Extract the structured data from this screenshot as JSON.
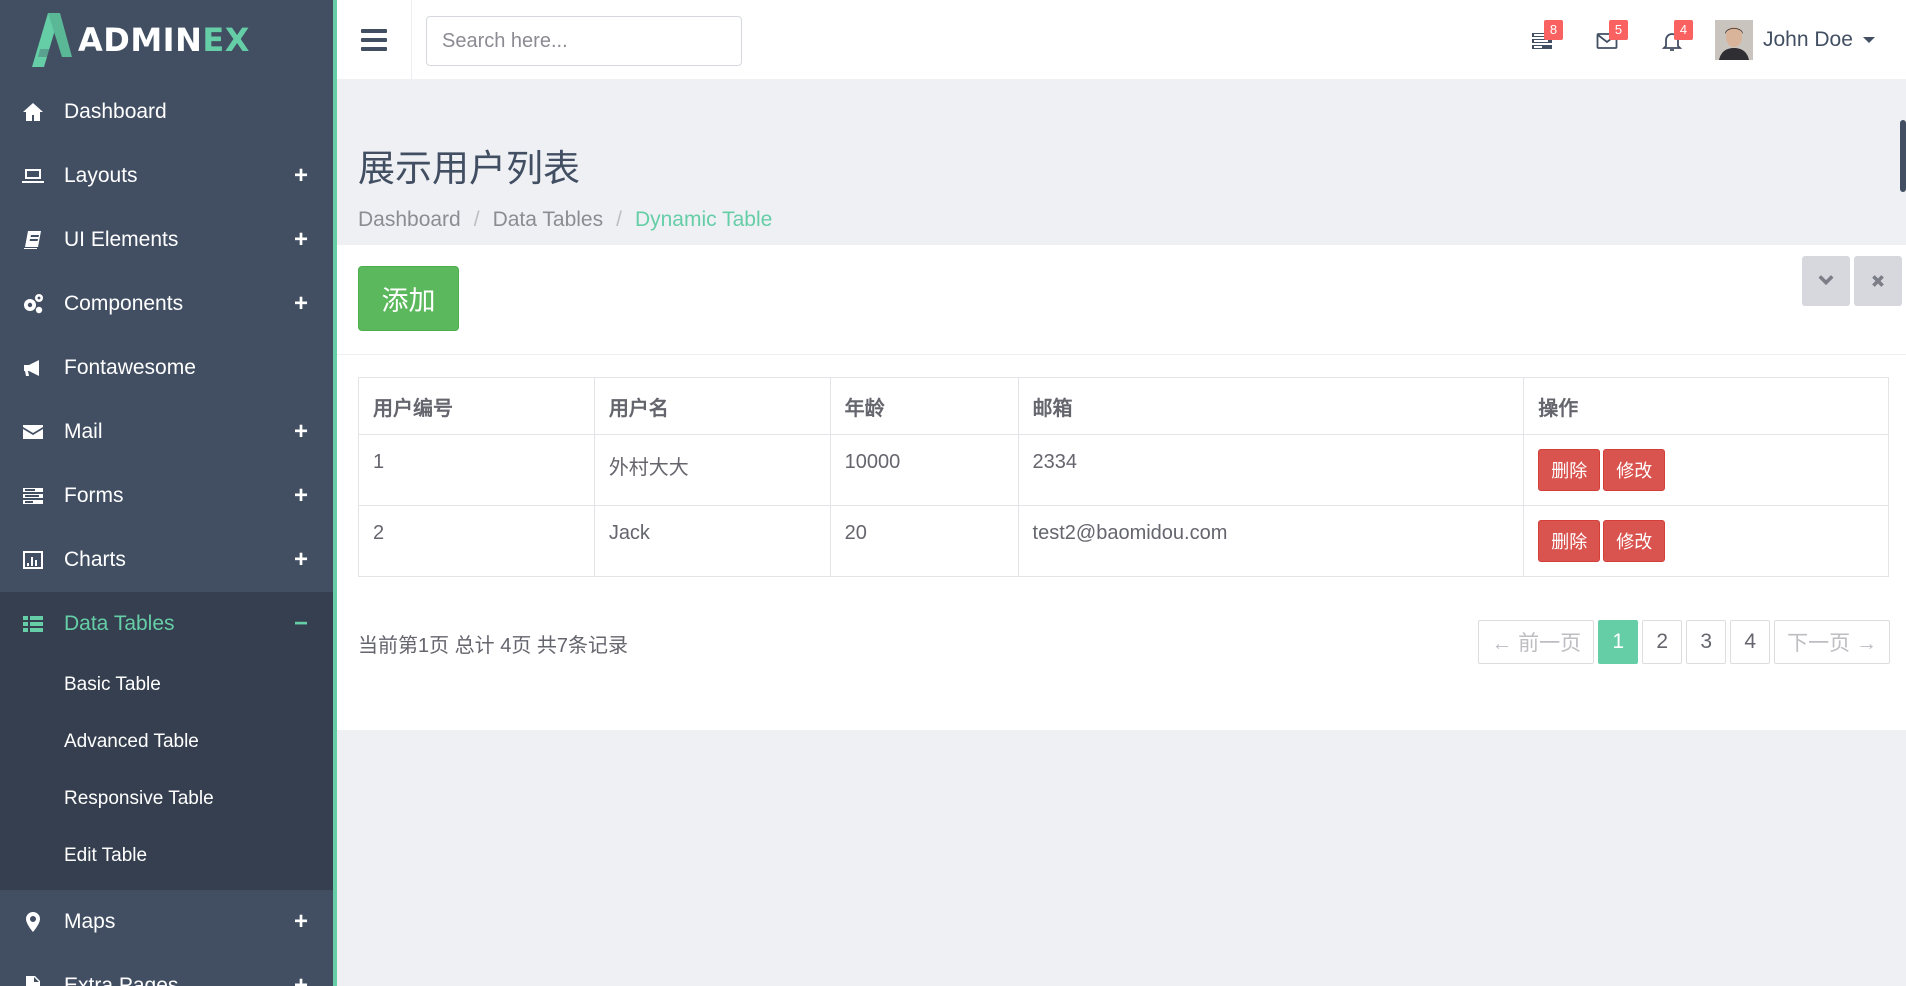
{
  "brand": {
    "name_main": "ADMIN",
    "name_accent": "EX"
  },
  "sidebar": {
    "items": [
      {
        "label": "Dashboard",
        "icon": "home-icon",
        "toggle": ""
      },
      {
        "label": "Layouts",
        "icon": "laptop-icon",
        "toggle": "+"
      },
      {
        "label": "UI Elements",
        "icon": "book-icon",
        "toggle": "+"
      },
      {
        "label": "Components",
        "icon": "cogs-icon",
        "toggle": "+"
      },
      {
        "label": "Fontawesome",
        "icon": "bullhorn-icon",
        "toggle": ""
      },
      {
        "label": "Mail",
        "icon": "envelope-icon",
        "toggle": "+"
      },
      {
        "label": "Forms",
        "icon": "tasks-icon",
        "toggle": "+"
      },
      {
        "label": "Charts",
        "icon": "bar-chart-icon",
        "toggle": "+"
      },
      {
        "label": "Data Tables",
        "icon": "th-list-icon",
        "toggle": "−"
      },
      {
        "label": "Maps",
        "icon": "map-marker-icon",
        "toggle": "+"
      },
      {
        "label": "Extra Pages",
        "icon": "file-icon",
        "toggle": "+"
      }
    ],
    "subitems": [
      "Basic Table",
      "Advanced Table",
      "Responsive Table",
      "Edit Table"
    ]
  },
  "header": {
    "search_placeholder": "Search here...",
    "notifications": [
      {
        "icon": "tasks-icon",
        "count": "8"
      },
      {
        "icon": "envelope-icon",
        "count": "5"
      },
      {
        "icon": "bell-icon",
        "count": "4"
      }
    ],
    "user_name": "John Doe"
  },
  "page": {
    "title": "展示用户列表",
    "breadcrumb": [
      "Dashboard",
      "Data Tables",
      "Dynamic Table"
    ]
  },
  "panel": {
    "add_label": "添加",
    "columns": [
      "用户编号",
      "用户名",
      "年龄",
      "邮箱",
      "操作"
    ],
    "rows": [
      {
        "id": "1",
        "name": "外村大大",
        "age": "10000",
        "email": "2334"
      },
      {
        "id": "2",
        "name": "Jack",
        "age": "20",
        "email": "test2@baomidou.com"
      }
    ],
    "delete_label": "删除",
    "edit_label": "修改",
    "page_info": "当前第1页 总计 4页 共7条记录",
    "pager": {
      "prev": "← 前一页",
      "pages": [
        "1",
        "2",
        "3",
        "4"
      ],
      "next": "下一页 →",
      "current": "1"
    }
  },
  "colors": {
    "sidebar_bg": "#424f63",
    "accent": "#65cea7",
    "success": "#5cb85c",
    "danger": "#d9534f",
    "badge": "#fa6262"
  }
}
